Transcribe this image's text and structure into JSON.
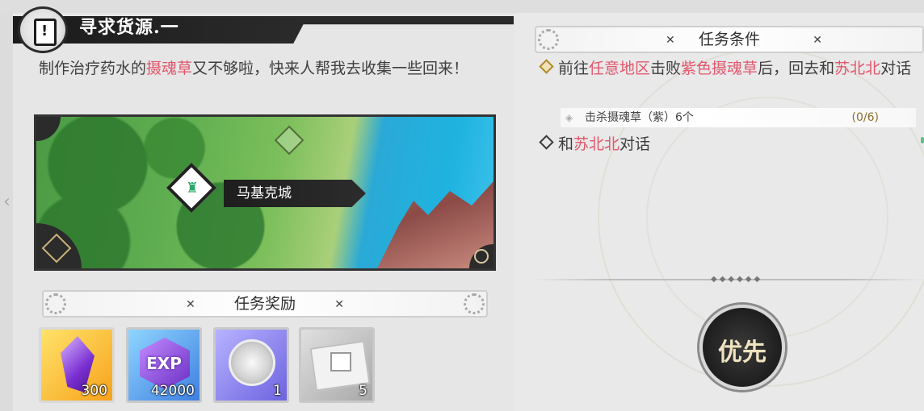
{
  "quest": {
    "title": "寻求货源.一",
    "description_parts": [
      "制作治疗药水的",
      "摄魂草",
      "又不够啦，快来人帮我去收集一些回来！"
    ]
  },
  "map": {
    "location_label": "马基克城"
  },
  "rewards_section": {
    "title": "任务奖励",
    "items": [
      {
        "name": "purple-crystal",
        "qty": "300"
      },
      {
        "name": "exp-crystal",
        "label": "EXP",
        "qty": "42000"
      },
      {
        "name": "silver-coin",
        "qty": "1"
      },
      {
        "name": "costume-scroll",
        "qty": "5"
      }
    ]
  },
  "conditions_section": {
    "title": "任务条件",
    "req1_parts": [
      "前往",
      "任意地区",
      "击败",
      "紫色摄魂草",
      "后，回去和",
      "苏北北",
      "对话"
    ],
    "progress_text": "击杀摄魂草（紫）6个",
    "progress_value": "(0/6)",
    "req2_parts": [
      "和",
      "苏北北",
      "对话"
    ]
  },
  "priority_button": {
    "label": "优先"
  },
  "colors": {
    "highlight": "#e2566c",
    "dark": "#1e1e1e"
  }
}
